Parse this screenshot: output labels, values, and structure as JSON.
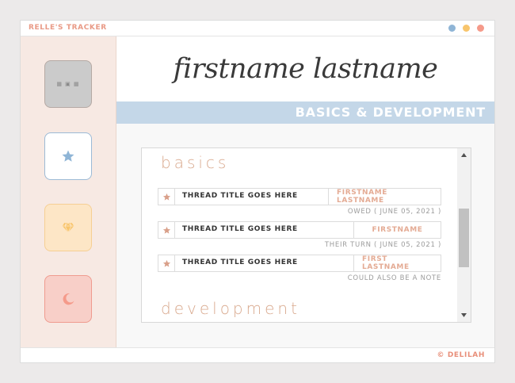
{
  "app": {
    "title": "RELLE'S TRACKER",
    "window_dots": [
      {
        "name": "blue-dot",
        "color": "#8fb5d6"
      },
      {
        "name": "yellow-dot",
        "color": "#f8c56c"
      },
      {
        "name": "red-dot",
        "color": "#f59a8a"
      }
    ]
  },
  "sidebar": {
    "items": [
      {
        "icon": "grid-icon",
        "glyph": "▦ ▣ ▦",
        "selected": false
      },
      {
        "icon": "star-icon",
        "color": "#8fb5d6",
        "selected": true
      },
      {
        "icon": "diamond-icon",
        "color": "#f8c56c",
        "selected": false
      },
      {
        "icon": "moon-icon",
        "color": "#f59a8a",
        "selected": false
      }
    ]
  },
  "header": {
    "name": "firstname lastname"
  },
  "banner": {
    "text": "BASICS & DEVELOPMENT"
  },
  "content": {
    "sections": [
      {
        "title": "basics",
        "threads": [
          {
            "title": "THREAD TITLE GOES HERE",
            "partner": "FIRSTNAME LASTNAME",
            "status": "OWED ( JUNE 05, 2021 )"
          },
          {
            "title": "THREAD TITLE GOES HERE",
            "partner": "FIRSTNAME",
            "status": "THEIR TURN ( JUNE 05, 2021 )"
          },
          {
            "title": "THREAD TITLE GOES HERE",
            "partner": "FIRST LASTNAME",
            "status": "COULD ALSO BE A NOTE"
          }
        ]
      },
      {
        "title": "development",
        "threads": []
      }
    ]
  },
  "footer": {
    "credit": "© DELILAH"
  },
  "colors": {
    "accent_peach": "#e4ab94",
    "banner_blue": "#c4d7e8",
    "sidebar_bg": "#f7e9e3",
    "star_color": "#d9a08a"
  }
}
